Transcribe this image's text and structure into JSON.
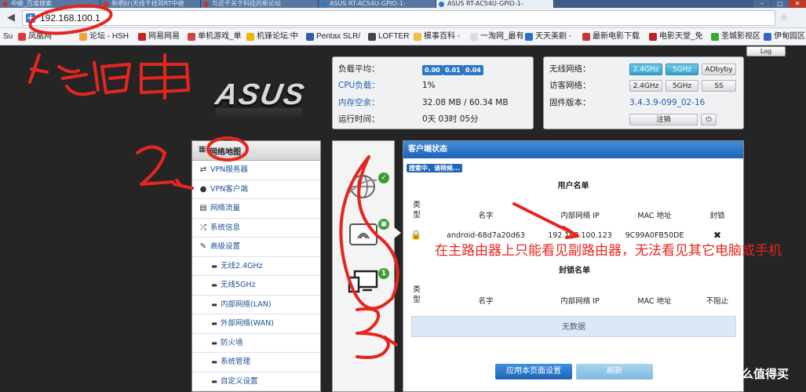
{
  "browser": {
    "tabs": [
      {
        "label": "中继_百度搜索"
      },
      {
        "label": "新晒好|天线干找到RT中继"
      },
      {
        "label": "与近千关于科技的新论坛"
      },
      {
        "label": "ASUS RT-AC54U-GPIO-1-"
      },
      {
        "label": "ASUS RT-AC54U-GPIO-1-"
      }
    ],
    "url": "192.168.100.1",
    "bookmarks": [
      {
        "label": "Su"
      },
      {
        "label": "凤凰网"
      },
      {
        "label": "论坛 - HSH"
      },
      {
        "label": "网易网易"
      },
      {
        "label": "单机游戏_单"
      },
      {
        "label": "机锋论坛:中"
      },
      {
        "label": "Pentax SLR/"
      },
      {
        "label": "LOFTER"
      },
      {
        "label": "模事百科 -"
      },
      {
        "label": "一淘网_最有"
      },
      {
        "label": "天天美剧 -"
      },
      {
        "label": "最新电影下载"
      },
      {
        "label": "电影天堂_免"
      },
      {
        "label": "圣城影视区"
      },
      {
        "label": "伊甸园区"
      }
    ]
  },
  "logo": "ASUS",
  "logout": "Log",
  "status": {
    "load_label": "负载平均：",
    "load_values": [
      "0.00",
      "0.01",
      "0.04"
    ],
    "cpu_label": "CPU负载：",
    "cpu_value": "1%",
    "mem_label": "内存空余：",
    "mem_value": "32.08 MB / 60.34 MB",
    "uptime_label": "运行时间：",
    "uptime_value": "0天 03时 05分"
  },
  "wireless": {
    "wifi_label": "无线网络：",
    "wifi_buttons": [
      "2.4GHz",
      "5GHz",
      "ADbyby"
    ],
    "guest_label": "访客网络：",
    "guest_buttons": [
      "2.4GHz",
      "5GHz",
      "SS"
    ],
    "fw_label": "固件版本：",
    "fw_value": "3.4.3.9-099_02-16",
    "logout_btn": "注销"
  },
  "sidebar": {
    "items": [
      {
        "label": "网络地图",
        "icon": "network-map-icon"
      },
      {
        "label": "VPN服务器",
        "icon": "vpn-server-icon"
      },
      {
        "label": "VPN客户端",
        "icon": "globe-icon"
      },
      {
        "label": "网络流量",
        "icon": "traffic-icon"
      },
      {
        "label": "系统信息",
        "icon": "shuffle-icon"
      },
      {
        "label": "高级设置",
        "icon": "wrench-icon"
      }
    ],
    "subitems": [
      {
        "label": "无线2.4GHz"
      },
      {
        "label": "无线5GHz"
      },
      {
        "label": "内部网络(LAN)"
      },
      {
        "label": "外部网络(WAN)"
      },
      {
        "label": "防火墙"
      },
      {
        "label": "系统管理"
      },
      {
        "label": "自定义设置"
      }
    ]
  },
  "map": {
    "badges": [
      "1"
    ]
  },
  "client": {
    "title": "客户端状态",
    "scanning": "搜索中，请稍候...",
    "section1": "用户名单",
    "columns1": [
      "类型",
      "名字",
      "内部网络 IP",
      "MAC 地址",
      "封锁"
    ],
    "rows": [
      {
        "name": "android-68d7a20d63",
        "ip": "192.168.100.123",
        "mac": "9C99A0FB50DE"
      }
    ],
    "section2": "封锁名单",
    "columns2": [
      "类型",
      "名字",
      "内部网络 IP",
      "MAC 地址",
      "不阻止"
    ],
    "empty": "无数据",
    "apply_btn": "应用本页面设置",
    "refresh_btn": "刷新"
  },
  "annotation": "在主路由器上只能看见副路由器，无法看见其它电脑或手机",
  "watermark": "什么值得买",
  "colors": {
    "accent": "#2e77c5",
    "annotation": "#e5261f"
  }
}
